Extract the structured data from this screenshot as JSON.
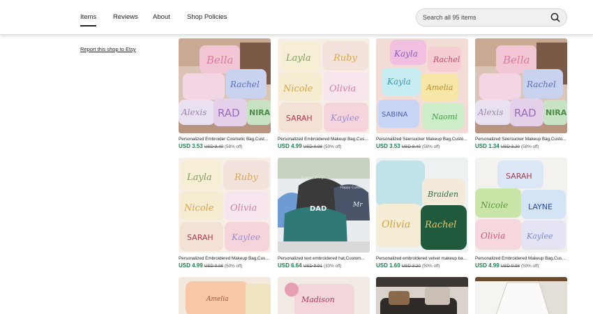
{
  "nav": {
    "tabs": [
      {
        "label": "Items"
      },
      {
        "label": "Reviews"
      },
      {
        "label": "About"
      },
      {
        "label": "Shop Policies"
      }
    ],
    "search_placeholder": "Search all 95 items",
    "search_icon": "magnifier-icon"
  },
  "sidebar": {
    "report_link": "Report this shop to Etsy"
  },
  "accent_colors": {
    "price": "#1a7f4b"
  },
  "products": [
    {
      "title": "Personalized Embroider Cosmetic Bag,Cust...",
      "price": "USD 3.53",
      "original": "USD 8.40",
      "discount": "(58% off)",
      "names": [
        "Bella",
        "Rachel",
        "Alexis",
        "RAD",
        "NIRA"
      ]
    },
    {
      "title": "Personalized Embroidered Makeup Bag,Custo...",
      "price": "USD 4.99",
      "original": "USD 9.98",
      "discount": "(50% off)",
      "names": [
        "Layla",
        "Ruby",
        "Nicole",
        "Olivia",
        "SARAH",
        "Kaylee"
      ]
    },
    {
      "title": "Personalized Seersucker Makeup Bag,Custo...",
      "price": "USD 3.53",
      "original": "USD 8.40",
      "discount": "(58% off)",
      "names": [
        "Kayla",
        "Rachel",
        "Kayla",
        "Amelia",
        "SABINA",
        "Naomi"
      ]
    },
    {
      "title": "Personalized Seersucker Makeup Bag,Custo...",
      "price": "USD 1.34",
      "original": "USD 3.20",
      "discount": "(58% off)",
      "names": [
        "Bella",
        "Rachel",
        "Alexis",
        "RAD",
        "NIRA"
      ]
    },
    {
      "title": "Personalized Embroidered Makeup Bag,Custo...",
      "price": "USD 4.99",
      "original": "USD 9.98",
      "discount": "(50% off)",
      "names": [
        "Layla",
        "Ruby",
        "Nicole",
        "Olivia",
        "SARAH",
        "Kaylee"
      ]
    },
    {
      "title": "Personalized text embroidered hat,Custom...",
      "price": "USD 6.64",
      "original": "USD 9.91",
      "discount": "(33% off)",
      "names": [
        "DAD",
        "Mr",
        "Custom Design",
        "Happy Customer"
      ]
    },
    {
      "title": "Personalized embroidered velvet makeup ba...",
      "price": "USD 1.60",
      "original": "USD 3.20",
      "discount": "(50% off)",
      "names": [
        "Braiden",
        "Olivia",
        "Rachel"
      ]
    },
    {
      "title": "Personalized Embroidered Makeup Bag,Custo...",
      "price": "USD 4.99",
      "original": "USD 9.98",
      "discount": "(50% off)",
      "names": [
        "SARAH",
        "Nicole",
        "LAYNE",
        "Olivia",
        "Kaylee"
      ]
    },
    {
      "names": [
        "Amelia"
      ]
    },
    {
      "names": [
        "Madison"
      ]
    },
    {
      "names": []
    },
    {
      "names": []
    }
  ]
}
